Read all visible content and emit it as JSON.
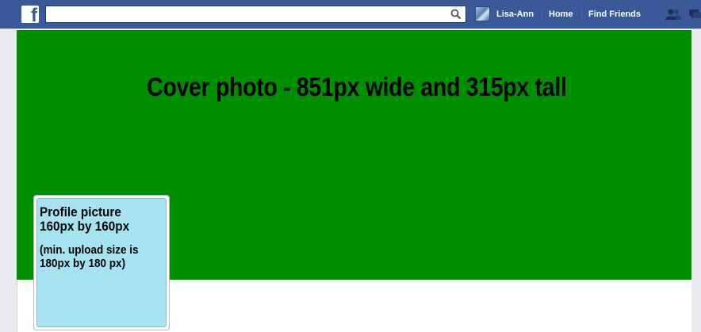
{
  "header": {
    "logo_letter": "f",
    "search": {
      "value": "",
      "placeholder": ""
    },
    "user_name": "Lisa-Ann",
    "nav": [
      "Home",
      "Find Friends"
    ],
    "colors": {
      "bar": "#3b5998",
      "text": "#ffffff"
    }
  },
  "cover": {
    "text": "Cover photo - 851px wide and 315px tall",
    "color": "#008f00"
  },
  "profile": {
    "title": "Profile picture\n160px by 160px",
    "note": "(min. upload size is\n180px by 180 px)",
    "color": "#a6e3f1"
  }
}
